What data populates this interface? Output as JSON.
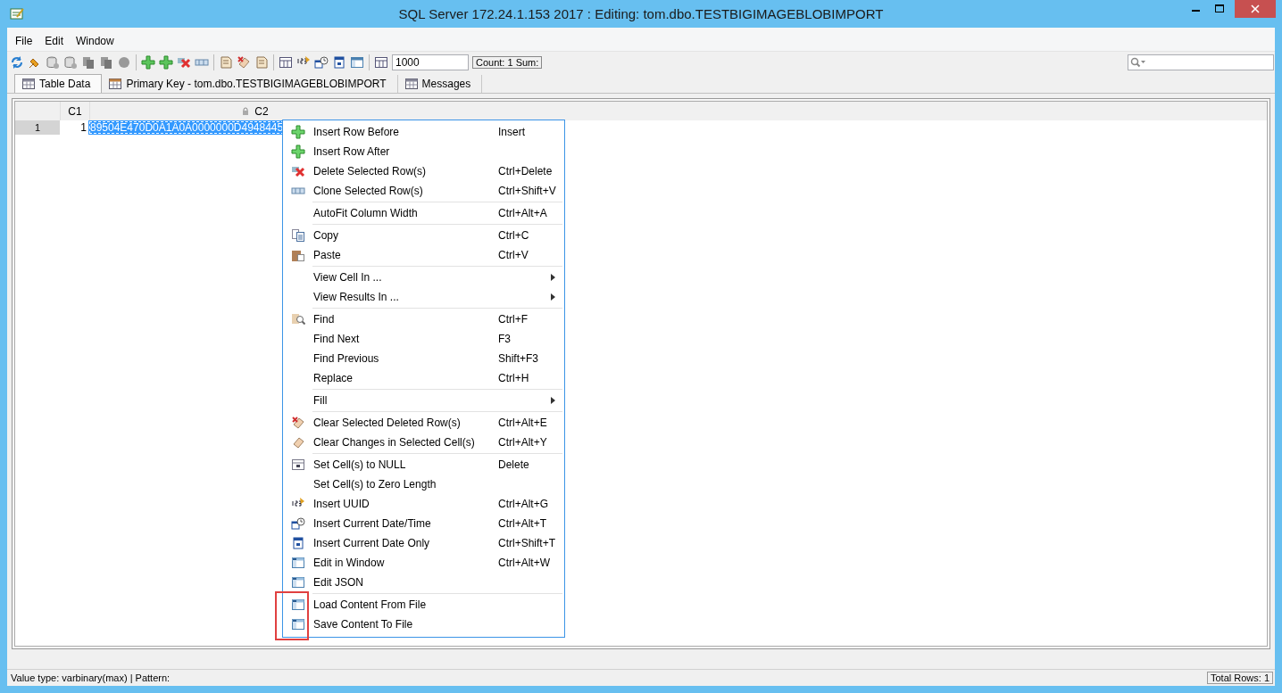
{
  "window": {
    "title": "SQL Server 172.24.1.153 2017 : Editing: tom.dbo.TESTBIGIMAGEBLOBIMPORT"
  },
  "menu_bar": [
    "File",
    "Edit",
    "Window"
  ],
  "toolbar": {
    "row_limit": "1000",
    "summary": "Count: 1  Sum:"
  },
  "tabs": [
    {
      "label": "Table Data",
      "selected": true
    },
    {
      "label": "Primary Key - tom.dbo.TESTBIGIMAGEBLOBIMPORT",
      "selected": false
    },
    {
      "label": "Messages",
      "selected": false
    }
  ],
  "table": {
    "columns": [
      {
        "label": "C1",
        "locked": false
      },
      {
        "label": "C2",
        "locked": true
      }
    ],
    "rows": [
      {
        "number": "1",
        "cells": [
          {
            "text": "1",
            "selected": false
          },
          {
            "text": "89504E470D0A1A0A0000000D4948445",
            "selected": true
          }
        ]
      }
    ]
  },
  "context_menu": {
    "sections": [
      {
        "highlighted": false,
        "items": [
          {
            "label": "Insert Row Before",
            "shortcut": "Insert",
            "submenu": false
          },
          {
            "label": "Insert Row After",
            "submenu": false
          },
          {
            "label": "Delete Selected Row(s)",
            "shortcut": "Ctrl+Delete",
            "submenu": false
          },
          {
            "label": "Clone Selected Row(s)",
            "shortcut": "Ctrl+Shift+V",
            "submenu": false
          }
        ]
      },
      {
        "highlighted": false,
        "items": [
          {
            "label": "AutoFit Column Width",
            "shortcut": "Ctrl+Alt+A",
            "submenu": false
          }
        ]
      },
      {
        "highlighted": false,
        "items": [
          {
            "label": "Copy",
            "shortcut": "Ctrl+C",
            "submenu": false
          },
          {
            "label": "Paste",
            "shortcut": "Ctrl+V",
            "submenu": false
          }
        ]
      },
      {
        "highlighted": false,
        "items": [
          {
            "label": "View Cell In ...",
            "submenu": true
          },
          {
            "label": "View Results In ...",
            "submenu": true
          }
        ]
      },
      {
        "highlighted": false,
        "items": [
          {
            "label": "Find",
            "shortcut": "Ctrl+F",
            "submenu": false
          },
          {
            "label": "Find Next",
            "shortcut": "F3",
            "submenu": false
          },
          {
            "label": "Find Previous",
            "shortcut": "Shift+F3",
            "submenu": false
          },
          {
            "label": "Replace",
            "shortcut": "Ctrl+H",
            "submenu": false
          }
        ]
      },
      {
        "highlighted": false,
        "items": [
          {
            "label": "Fill",
            "submenu": true
          }
        ]
      },
      {
        "highlighted": false,
        "items": [
          {
            "label": "Clear Selected Deleted Row(s)",
            "shortcut": "Ctrl+Alt+E",
            "submenu": false
          },
          {
            "label": "Clear Changes in Selected Cell(s)",
            "shortcut": "Ctrl+Alt+Y",
            "submenu": false
          }
        ]
      },
      {
        "highlighted": false,
        "items": [
          {
            "label": "Set Cell(s) to NULL",
            "shortcut": "Delete",
            "submenu": false
          },
          {
            "label": "Set Cell(s) to Zero Length",
            "submenu": false
          },
          {
            "label": "Insert UUID",
            "shortcut": "Ctrl+Alt+G",
            "submenu": false
          },
          {
            "label": "Insert Current Date/Time",
            "shortcut": "Ctrl+Alt+T",
            "submenu": false
          },
          {
            "label": "Insert Current Date Only",
            "shortcut": "Ctrl+Shift+T",
            "submenu": false
          },
          {
            "label": "Edit in Window",
            "shortcut": "Ctrl+Alt+W",
            "submenu": false
          },
          {
            "label": "Edit JSON",
            "submenu": false
          }
        ]
      },
      {
        "highlighted": true,
        "items": [
          {
            "label": "Load Content From File",
            "submenu": false
          },
          {
            "label": "Save Content To File",
            "submenu": false
          }
        ]
      }
    ]
  },
  "status_bar": {
    "left": "Value type: varbinary(max) | Pattern:",
    "right": "Total Rows: 1"
  }
}
